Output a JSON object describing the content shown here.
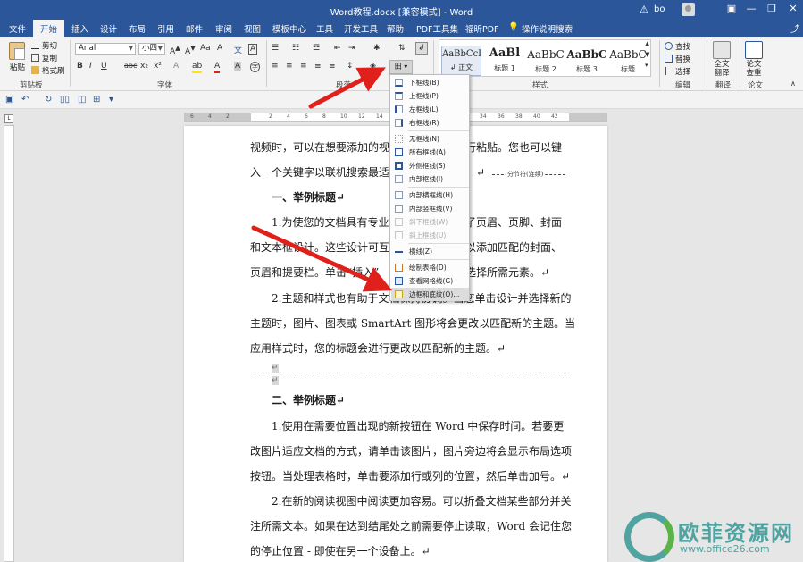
{
  "window": {
    "title": "Word教程.docx [兼容模式] - Word",
    "user": "bo",
    "minimize": "—",
    "restore": "❐",
    "close": "✕",
    "warn": "⚠"
  },
  "tabs": [
    "文件",
    "开始",
    "插入",
    "设计",
    "布局",
    "引用",
    "邮件",
    "审阅",
    "视图",
    "模板中心",
    "工具",
    "开发工具",
    "帮助",
    "PDF工具集",
    "福昕PDF",
    "操作说明搜索"
  ],
  "share_icon": "⤴",
  "ribbon": {
    "clipboard": {
      "paste": "粘贴",
      "cut": "剪切",
      "copy": "复制",
      "format_painter": "格式刷",
      "label": "剪贴板"
    },
    "font": {
      "name": "Arial",
      "size": "小四",
      "label": "字体",
      "bold": "B",
      "italic": "I",
      "underline": "U",
      "strike": "abc",
      "sub": "x₂",
      "sup": "x²"
    },
    "paragraph": {
      "label": "段落"
    },
    "styles": {
      "label": "样式",
      "items": [
        {
          "sample": "AaBbCcI",
          "name": "↲ 正文"
        },
        {
          "sample": "AaBl",
          "name": "标题 1"
        },
        {
          "sample": "AaBbC",
          "name": "标题 2"
        },
        {
          "sample": "AaBbC",
          "name": "标题 3"
        },
        {
          "sample": "AaBbC",
          "name": "标题"
        }
      ]
    },
    "editing": {
      "find": "查找",
      "replace": "替换",
      "select": "选择",
      "label": "编辑"
    },
    "fulltext": {
      "line1": "全文",
      "line2": "翻译",
      "label": "翻译"
    },
    "paper": {
      "line1": "论文",
      "line2": "查重",
      "label": "论文"
    }
  },
  "border_menu": {
    "trigger": "田",
    "items": [
      {
        "label": "下框线(B)",
        "disabled": false
      },
      {
        "label": "上框线(P)",
        "disabled": false
      },
      {
        "label": "左框线(L)",
        "disabled": false
      },
      {
        "label": "右框线(R)",
        "disabled": false
      },
      {
        "label": "无框线(N)",
        "disabled": false
      },
      {
        "label": "所有框线(A)",
        "disabled": false
      },
      {
        "label": "外侧框线(S)",
        "disabled": false
      },
      {
        "label": "内部框线(I)",
        "disabled": false
      },
      {
        "label": "内部横框线(H)",
        "disabled": false
      },
      {
        "label": "内部竖框线(V)",
        "disabled": false
      },
      {
        "label": "斜下框线(W)",
        "disabled": true
      },
      {
        "label": "斜上框线(U)",
        "disabled": true
      },
      {
        "label": "横线(Z)",
        "disabled": false
      },
      {
        "label": "绘制表格(D)",
        "disabled": false
      },
      {
        "label": "查看网格线(G)",
        "disabled": false
      },
      {
        "label": "边框和底纹(O)...",
        "disabled": false
      }
    ]
  },
  "document": {
    "line1": "视频时，可以在想要添加的视频",
    "line1b": "行粘贴。您也可以键",
    "line2": "入一个关键字以联机搜索最适",
    "line2b": "。↵",
    "section_break": "分节符(连续)",
    "heading1": "一、举例标题↵",
    "p1a": "1.为使您的文档具有专业外",
    "p1a2": "了页眉、页脚、封面",
    "p1b": "和文本框设计。这些设计可互为",
    "p1b2": "以添加匹配的封面、",
    "p1c": "页眉和提要栏。单击“插入”",
    "p1c2": "选择所需元素。↵",
    "p2a": "2.主题和样式也有助于文档保持协调。当您单击设计并选择新的",
    "p2b": "主题时，图片、图表或 SmartArt 图形将会更改以匹配新的主题。当",
    "p2c": "应用样式时，您的标题会进行更改以匹配新的主题。↵",
    "mark_small": "↵",
    "heading2": "二、举例标题↵",
    "p3a": "1.使用在需要位置出现的新按钮在 Word 中保存时间。若要更",
    "p3b": "改图片适应文档的方式，请单击该图片，图片旁边将会显示布局选项",
    "p3c": "按钮。当处理表格时，单击要添加行或列的位置，然后单击加号。↵",
    "p4a": "2.在新的阅读视图中阅读更加容易。可以折叠文档某些部分并关",
    "p4b": "注所需文本。如果在达到结尾处之前需要停止读取，Word 会记住您",
    "p4c": "的停止位置 - 即使在另一个设备上。↵"
  },
  "ruler_ticks": [
    "6",
    "4",
    "2",
    "2",
    "4",
    "6",
    "8",
    "10",
    "12",
    "14",
    "16",
    "18",
    "20",
    "22",
    "24",
    "26",
    "28",
    "30",
    "32",
    "34",
    "36",
    "38",
    "40",
    "42"
  ],
  "watermark": {
    "text": "欧菲资源网",
    "url": "www.office26.com"
  },
  "colors": {
    "accent": "#2b579a",
    "arrow": "#e0201b",
    "watermark": "#4fa3a0"
  }
}
